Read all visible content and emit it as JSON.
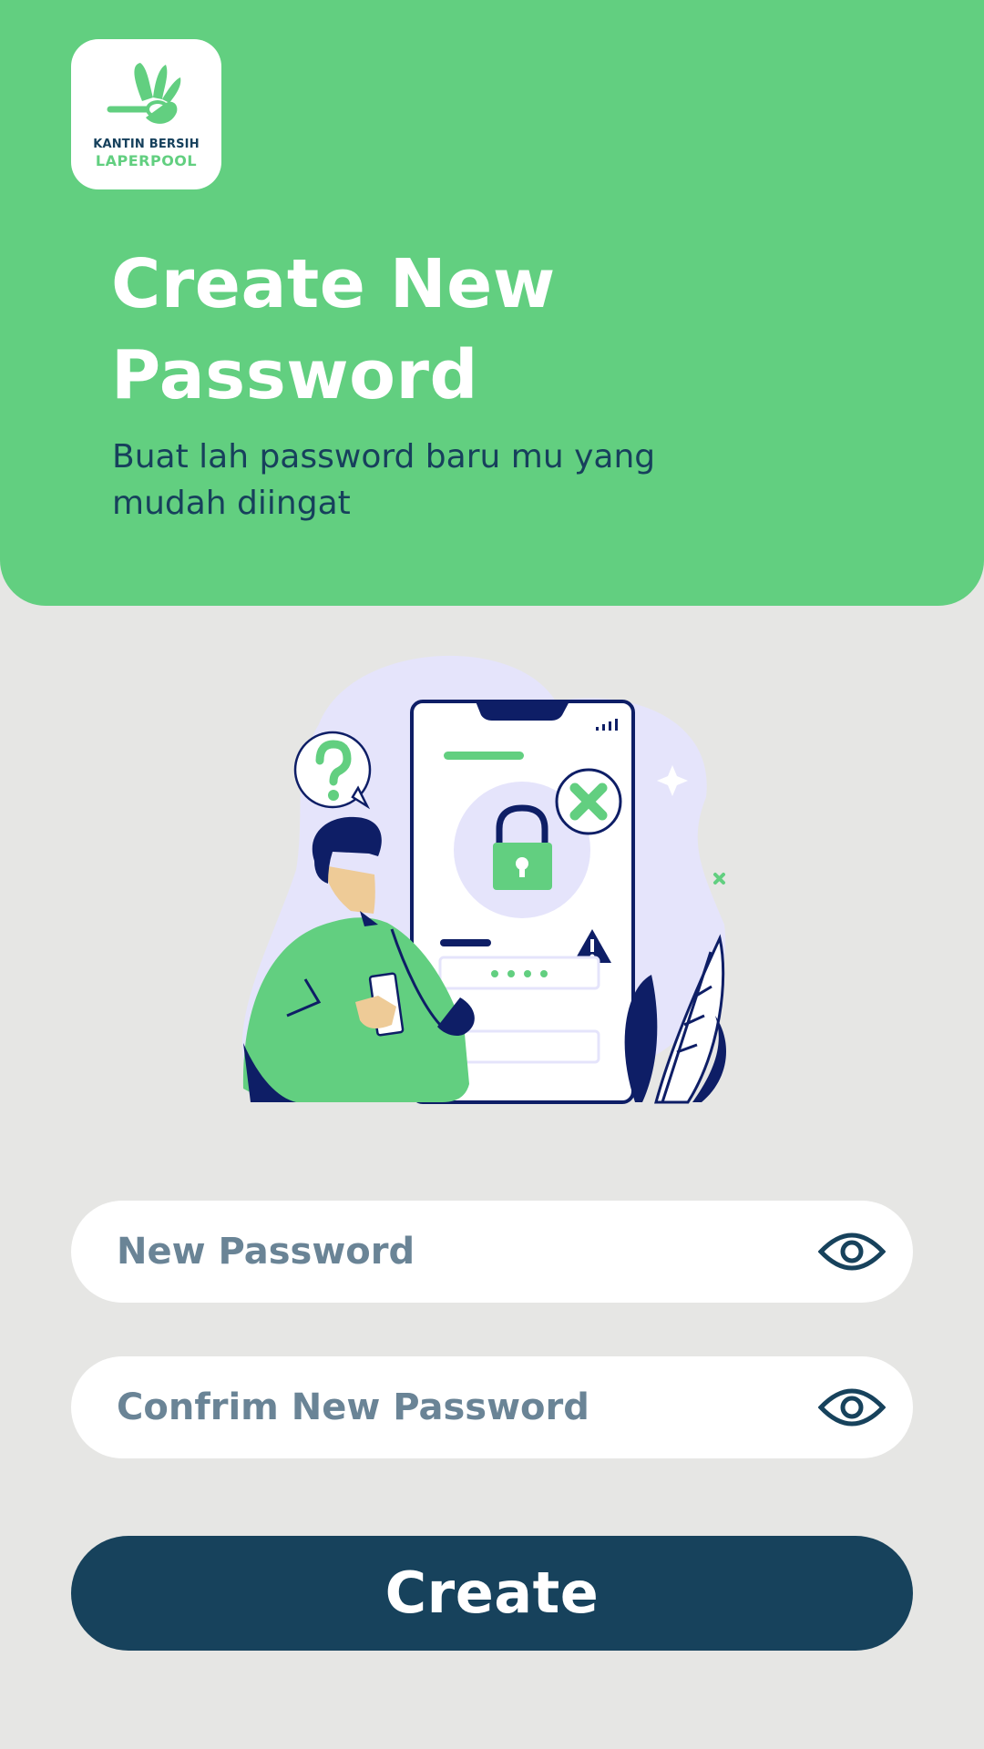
{
  "logo": {
    "line1": "KANTIN BERSIH",
    "line2": "LAPERPOOL"
  },
  "header": {
    "title_line1": "Create New",
    "title_line2": "Password",
    "subtitle": "Buat lah password baru mu yang mudah diingat"
  },
  "form": {
    "new_password": {
      "placeholder": "New Password",
      "value": ""
    },
    "confirm_password": {
      "placeholder": "Confrim New Password",
      "value": ""
    },
    "submit_label": "Create"
  },
  "icons": {
    "logo": "hand-spoon-logo-icon",
    "toggle_visibility": "eye-icon"
  },
  "colors": {
    "header_bg": "#62cf80",
    "page_bg": "#e6e6e4",
    "primary_dark": "#17425c",
    "placeholder": "#6a8496",
    "white": "#ffffff"
  }
}
